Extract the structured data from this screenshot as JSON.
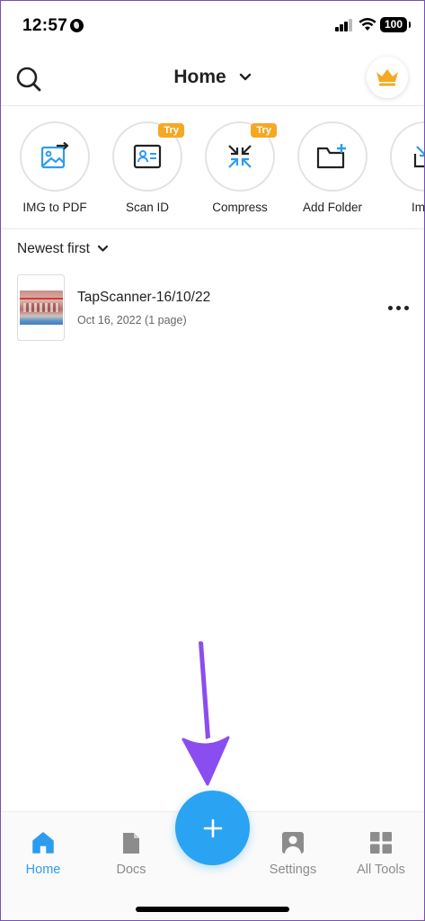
{
  "status_bar": {
    "time": "12:57",
    "battery": "100",
    "icons": [
      "globe-icon",
      "signal-icon",
      "wifi-icon",
      "battery-icon"
    ]
  },
  "header": {
    "title": "Home",
    "icons": {
      "left": "search-icon",
      "title_suffix": "chevron-down-icon",
      "right": "crown-icon"
    },
    "crown_color": "#f6a823"
  },
  "tools": [
    {
      "label": "IMG to PDF",
      "icon": "image-to-pdf-icon",
      "badge": ""
    },
    {
      "label": "Scan ID",
      "icon": "id-card-icon",
      "badge": "Try"
    },
    {
      "label": "Compress",
      "icon": "compress-icon",
      "badge": "Try"
    },
    {
      "label": "Add Folder",
      "icon": "add-folder-icon",
      "badge": ""
    },
    {
      "label": "Impo",
      "icon": "import-icon",
      "badge": ""
    }
  ],
  "sort": {
    "label": "Newest first"
  },
  "documents": [
    {
      "title": "TapScanner-16/10/22",
      "meta": "Oct 16, 2022 (1 page)"
    }
  ],
  "tabbar": {
    "tabs": [
      {
        "label": "Home",
        "icon": "home-icon",
        "active": true
      },
      {
        "label": "Docs",
        "icon": "document-icon",
        "active": false
      },
      {
        "label": "Settings",
        "icon": "person-icon",
        "active": false
      },
      {
        "label": "All Tools",
        "icon": "grid-icon",
        "active": false
      }
    ],
    "fab_icon": "plus-icon"
  },
  "colors": {
    "accent": "#2aa3f2",
    "tool_icon": "#2d9cf0",
    "badge": "#f6a823",
    "annotation_arrow": "#8a4df0",
    "inactive_tab": "#8c8c8c"
  }
}
